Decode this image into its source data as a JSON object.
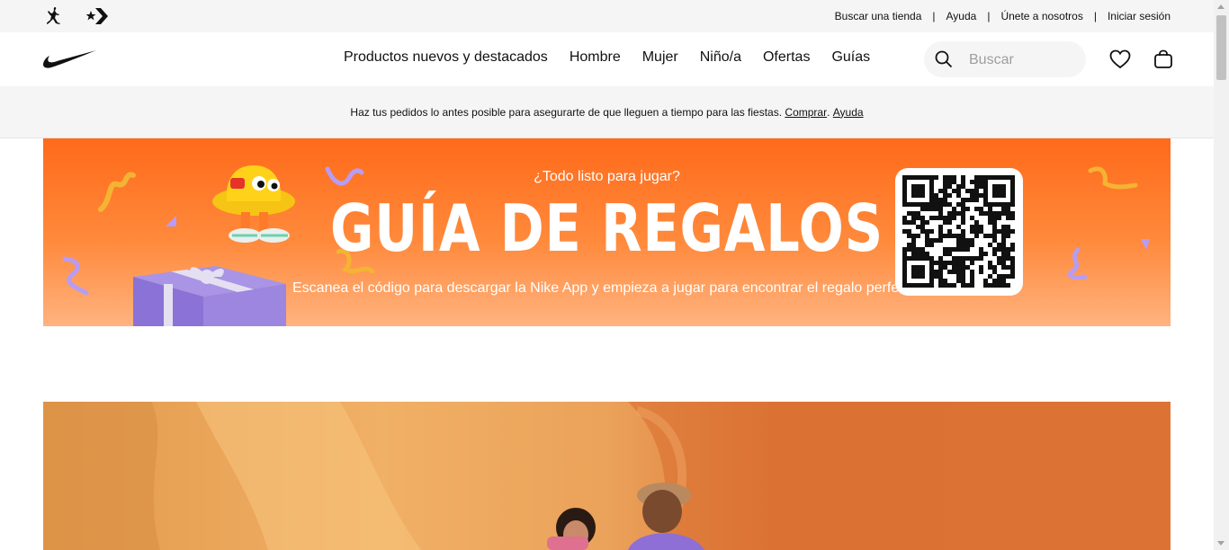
{
  "utility": {
    "links": [
      "Buscar una tienda",
      "Ayuda",
      "Únete a nosotros",
      "Iniciar sesión"
    ]
  },
  "nav": {
    "items": [
      "Productos nuevos y destacados",
      "Hombre",
      "Mujer",
      "Niño/a",
      "Ofertas",
      "Guías"
    ],
    "search_placeholder": "Buscar"
  },
  "promo": {
    "text": "Haz tus pedidos lo antes posible para asegurarte de que lleguen a tiempo para las fiestas.",
    "link_shop": "Comprar",
    "link_help": "Ayuda"
  },
  "banner": {
    "kicker": "¿Todo listo para jugar?",
    "title": "GUÍA DE REGALOS",
    "subtitle": "Escanea el código para descargar la Nike App y empieza a jugar para encontrar el regalo perfecto."
  },
  "icons": {
    "jordan": "jordan-logo-icon",
    "converse": "converse-logo-icon",
    "nike": "nike-swoosh-icon",
    "search": "search-icon",
    "favorites": "heart-icon",
    "bag": "bag-icon"
  },
  "colors": {
    "banner_orange": "#ff6a1a",
    "text": "#111111",
    "bar_gray": "#f5f5f5"
  }
}
